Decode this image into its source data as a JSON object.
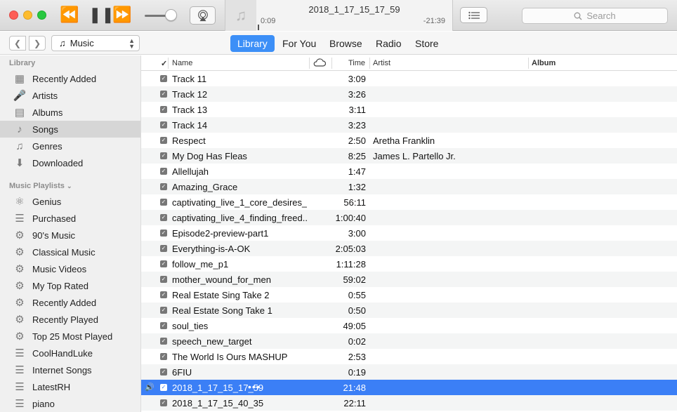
{
  "player": {
    "now_playing_title": "2018_1_17_15_17_59",
    "elapsed": "0:09",
    "remaining": "-21:39",
    "progress_fraction": 0.007
  },
  "search": {
    "placeholder": "Search"
  },
  "nav": {
    "media_kind": "Music",
    "tabs": [
      {
        "label": "Library",
        "active": true
      },
      {
        "label": "For You",
        "active": false
      },
      {
        "label": "Browse",
        "active": false
      },
      {
        "label": "Radio",
        "active": false
      },
      {
        "label": "Store",
        "active": false
      }
    ]
  },
  "sidebar": {
    "library_header": "Library",
    "library_items": [
      {
        "label": "Recently Added",
        "icon": "grid-icon"
      },
      {
        "label": "Artists",
        "icon": "microphone-icon"
      },
      {
        "label": "Albums",
        "icon": "album-icon"
      },
      {
        "label": "Songs",
        "icon": "note-icon",
        "selected": true
      },
      {
        "label": "Genres",
        "icon": "guitar-icon"
      },
      {
        "label": "Downloaded",
        "icon": "download-icon"
      }
    ],
    "playlists_header": "Music Playlists",
    "playlists": [
      {
        "label": "Genius",
        "icon": "genius-icon"
      },
      {
        "label": "Purchased",
        "icon": "playlist-icon"
      },
      {
        "label": "90's Music",
        "icon": "gear-icon"
      },
      {
        "label": "Classical Music",
        "icon": "gear-icon"
      },
      {
        "label": "Music Videos",
        "icon": "gear-icon"
      },
      {
        "label": "My Top Rated",
        "icon": "gear-icon"
      },
      {
        "label": "Recently Added",
        "icon": "gear-icon"
      },
      {
        "label": "Recently Played",
        "icon": "gear-icon"
      },
      {
        "label": "Top 25 Most Played",
        "icon": "gear-icon"
      },
      {
        "label": "CoolHandLuke",
        "icon": "playlist-icon"
      },
      {
        "label": "Internet Songs",
        "icon": "playlist-icon"
      },
      {
        "label": "LatestRH",
        "icon": "playlist-icon"
      },
      {
        "label": "piano",
        "icon": "playlist-icon"
      }
    ]
  },
  "table": {
    "columns": {
      "check": "✓",
      "name": "Name",
      "time": "Time",
      "artist": "Artist",
      "album": "Album"
    },
    "rows": [
      {
        "name": "Track 11",
        "time": "3:09",
        "artist": ""
      },
      {
        "name": "Track 12",
        "time": "3:26",
        "artist": ""
      },
      {
        "name": "Track 13",
        "time": "3:11",
        "artist": ""
      },
      {
        "name": "Track 14",
        "time": "3:23",
        "artist": ""
      },
      {
        "name": "Respect",
        "time": "2:50",
        "artist": "Aretha Franklin"
      },
      {
        "name": "My Dog Has Fleas",
        "time": "8:25",
        "artist": "James L. Partello Jr."
      },
      {
        "name": "Allellujah",
        "time": "1:47",
        "artist": ""
      },
      {
        "name": "Amazing_Grace",
        "time": "1:32",
        "artist": ""
      },
      {
        "name": "captivating_live_1_core_desires_...",
        "time": "56:11",
        "artist": ""
      },
      {
        "name": "captivating_live_4_finding_freed...",
        "time": "1:00:40",
        "artist": ""
      },
      {
        "name": "Episode2-preview-part1",
        "time": "3:00",
        "artist": ""
      },
      {
        "name": "Everything-is-A-OK",
        "time": "2:05:03",
        "artist": ""
      },
      {
        "name": "follow_me_p1",
        "time": "1:11:28",
        "artist": ""
      },
      {
        "name": "mother_wound_for_men",
        "time": "59:02",
        "artist": ""
      },
      {
        "name": "Real Estate Sing Take 2",
        "time": "0:55",
        "artist": ""
      },
      {
        "name": "Real Estate Song Take 1",
        "time": "0:50",
        "artist": ""
      },
      {
        "name": "soul_ties",
        "time": "49:05",
        "artist": ""
      },
      {
        "name": "speech_new_target",
        "time": "0:02",
        "artist": ""
      },
      {
        "name": "The World Is Ours MASHUP",
        "time": "2:53",
        "artist": ""
      },
      {
        "name": "6FIU",
        "time": "0:19",
        "artist": ""
      },
      {
        "name": "2018_1_17_15_17_59",
        "time": "21:48",
        "artist": "",
        "playing": true,
        "more": "•••"
      },
      {
        "name": "2018_1_17_15_40_35",
        "time": "22:11",
        "artist": ""
      }
    ]
  }
}
